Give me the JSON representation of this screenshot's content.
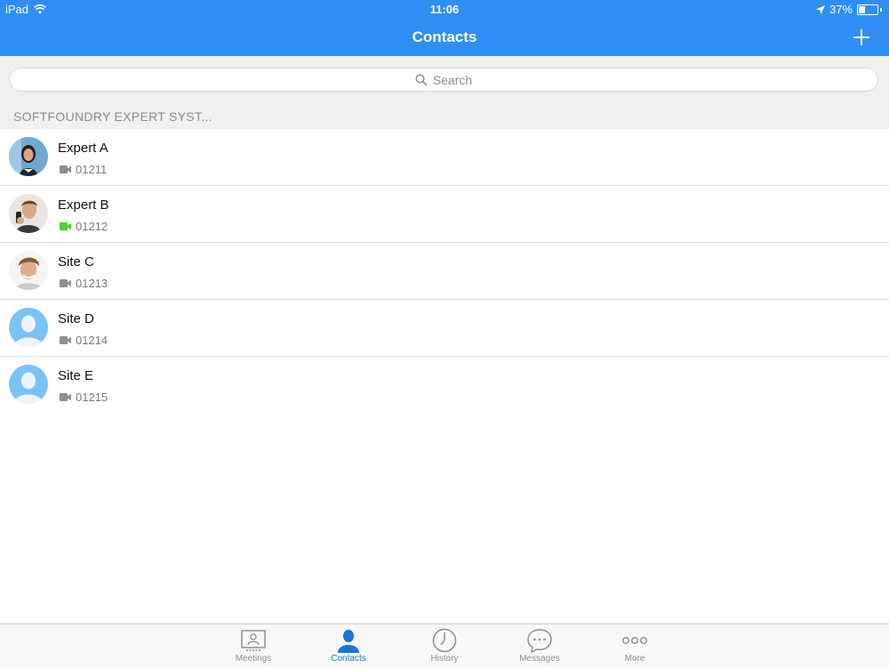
{
  "status_bar": {
    "device": "iPad",
    "time": "11:06",
    "battery_percent": "37%",
    "battery_level": 0.37
  },
  "nav": {
    "title": "Contacts",
    "add_icon": "plus-icon"
  },
  "search": {
    "placeholder": "Search"
  },
  "section": {
    "title": "SOFTFOUNDRY EXPERT SYST..."
  },
  "contacts": [
    {
      "name": "Expert A",
      "number": "01211",
      "status_color": "#8e8e8e",
      "avatar": "photo-woman"
    },
    {
      "name": "Expert B",
      "number": "01212",
      "status_color": "#4cd137",
      "avatar": "photo-man-phone"
    },
    {
      "name": "Site C",
      "number": "01213",
      "status_color": "#8e8e8e",
      "avatar": "photo-man-smiling"
    },
    {
      "name": "Site D",
      "number": "01214",
      "status_color": "#8e8e8e",
      "avatar": "default-avatar"
    },
    {
      "name": "Site E",
      "number": "01215",
      "status_color": "#8e8e8e",
      "avatar": "default-avatar"
    }
  ],
  "tabs": [
    {
      "label": "Meetings",
      "icon": "meetings-icon",
      "active": false
    },
    {
      "label": "Contacts",
      "icon": "contacts-icon",
      "active": true
    },
    {
      "label": "History",
      "icon": "clock-icon",
      "active": false
    },
    {
      "label": "Messages",
      "icon": "chat-bubble-icon",
      "active": false
    },
    {
      "label": "More",
      "icon": "more-dots-icon",
      "active": false
    }
  ],
  "colors": {
    "accent": "#2f8ef4",
    "active_tab": "#1976d2",
    "online": "#4cd137"
  }
}
